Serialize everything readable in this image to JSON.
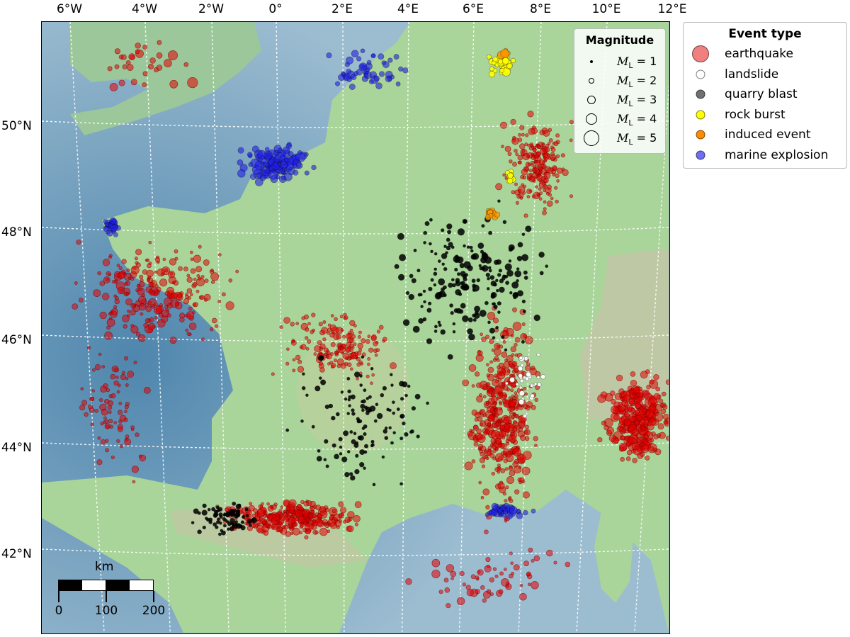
{
  "map": {
    "lon_ticks": [
      "6°W",
      "4°W",
      "2°W",
      "0°",
      "2°E",
      "4°E",
      "6°E",
      "8°E",
      "10°E",
      "12°E"
    ],
    "lat_ticks": [
      "50°N",
      "48°N",
      "46°N",
      "44°N",
      "42°N"
    ],
    "colors": {
      "sea": "#8fb2c7",
      "land": "#a9d49a",
      "grid": "#ffffff"
    }
  },
  "legend_magnitude": {
    "title": "Magnitude",
    "items": [
      {
        "math": "M",
        "sub": "L",
        "text": " = 1"
      },
      {
        "math": "M",
        "sub": "L",
        "text": " = 2"
      },
      {
        "math": "M",
        "sub": "L",
        "text": " = 3"
      },
      {
        "math": "M",
        "sub": "L",
        "text": " = 4"
      },
      {
        "math": "M",
        "sub": "L",
        "text": " = 5"
      }
    ]
  },
  "legend_event_type": {
    "title": "Event type",
    "items": [
      {
        "label": "earthquake",
        "color": "#f08080"
      },
      {
        "label": "landslide",
        "color": "#ffffff"
      },
      {
        "label": "quarry blast",
        "color": "#707070"
      },
      {
        "label": "rock burst",
        "color": "#ffff00"
      },
      {
        "label": "induced event",
        "color": "#ff8c00"
      },
      {
        "label": "marine explosion",
        "color": "#6f6ff0"
      }
    ]
  },
  "scalebar": {
    "unit": "km",
    "labels": [
      "0",
      "100",
      "200"
    ]
  }
}
